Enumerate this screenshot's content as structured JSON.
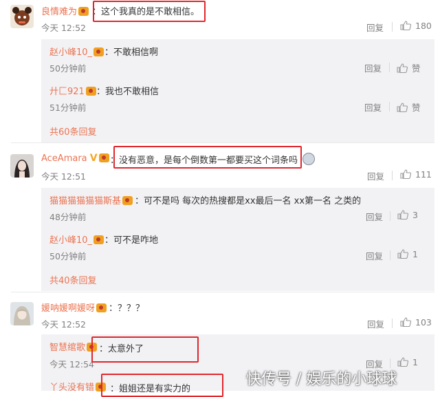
{
  "ui": {
    "reply_label": "回复",
    "like_zan": "赞",
    "colon": "："
  },
  "comments": [
    {
      "user": "良情难为",
      "text": "这个我真的是不敢相信。",
      "time": "今天 12:52",
      "likes": "180",
      "replies": [
        {
          "user": "赵小峰10_",
          "text": "不敢相信啊",
          "time": "50分钟前",
          "likes": "赞"
        },
        {
          "user": "廾匚921",
          "text": "我也不敢相信",
          "time": "51分钟前",
          "likes": "赞"
        }
      ],
      "more": "共60条回复"
    },
    {
      "user": "AceAmara",
      "text": "没有恶意，是每个倒数第一都要买这个词条吗",
      "time": "今天 12:51",
      "likes": "111",
      "replies": [
        {
          "user": "猫猫猫猫猫猫斯基",
          "text": "可不是吗 每次的热搜都是xx最后一名 xx第一名 之类的",
          "time": "48分钟前",
          "likes": "3"
        },
        {
          "user": "赵小峰10_",
          "text": "可不是咋地",
          "time": "50分钟前",
          "likes": "1"
        }
      ],
      "more": "共40条回复"
    },
    {
      "user": "媛呐媛啊媛呀",
      "text": "？？？",
      "time": "今天 12:52",
      "likes": "103",
      "replies": [
        {
          "user": "智慧绾歌",
          "text": "太意外了",
          "time": "今天 12:54",
          "likes": "1"
        },
        {
          "user": "丫头没有错",
          "text": "姐姐还是有实力的",
          "time": "",
          "likes": ""
        }
      ]
    }
  ],
  "watermark": "快传号 / 娱乐的小球球"
}
